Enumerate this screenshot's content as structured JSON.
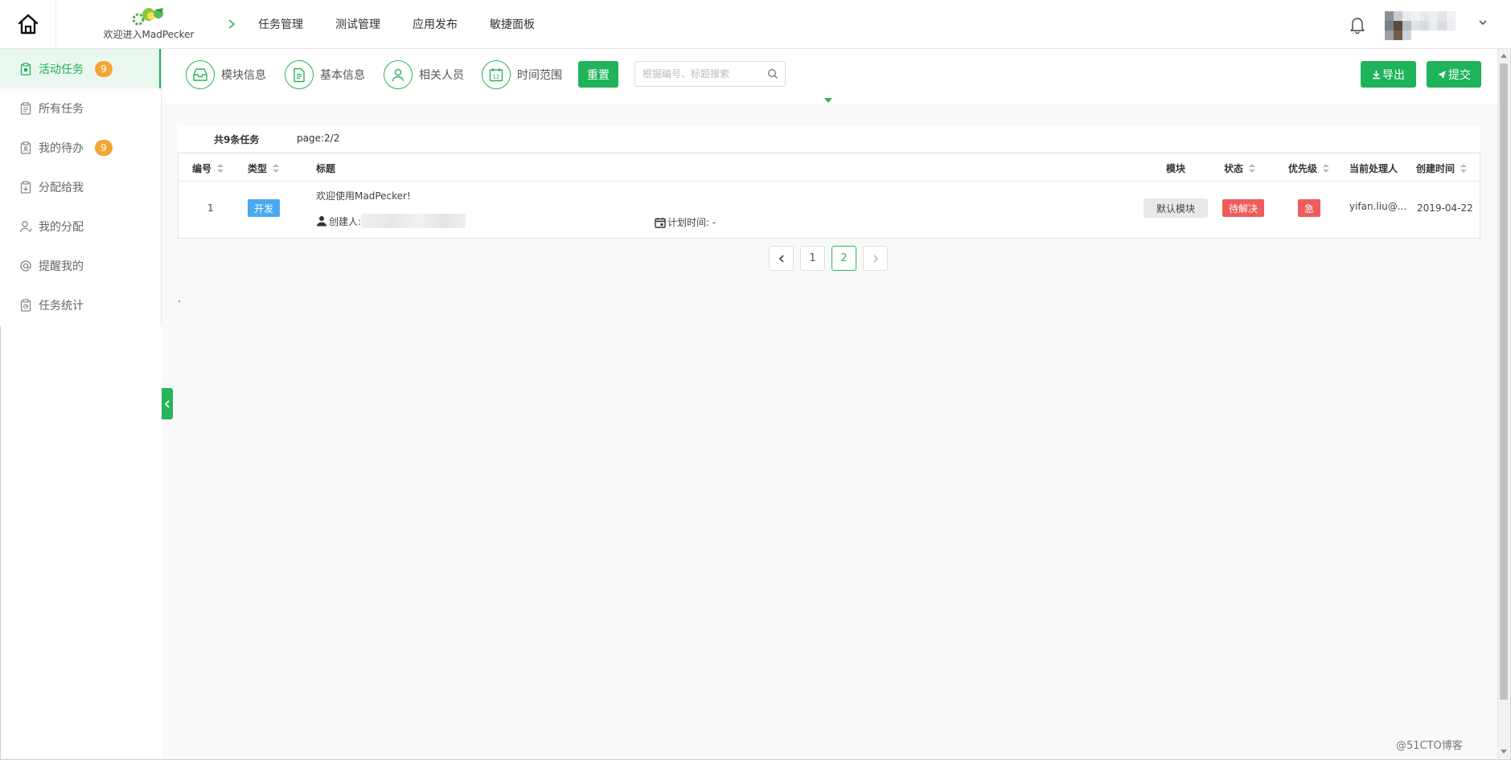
{
  "header": {
    "brand_text": "欢迎进入MadPecker",
    "nav": [
      "任务管理",
      "测试管理",
      "应用发布",
      "敏捷面板"
    ]
  },
  "sidebar": {
    "items": [
      {
        "label": "活动任务",
        "badge": "9",
        "active": true
      },
      {
        "label": "所有任务"
      },
      {
        "label": "我的待办",
        "badge": "9"
      },
      {
        "label": "分配给我"
      },
      {
        "label": "我的分配"
      },
      {
        "label": "提醒我的"
      },
      {
        "label": "任务统计"
      }
    ]
  },
  "filters": {
    "module": "模块信息",
    "basic": "基本信息",
    "people": "相关人员",
    "time": "时间范围",
    "calendar_day": "12",
    "reset": "重置",
    "search_placeholder": "根据编号、标题搜索",
    "export": "导出",
    "submit": "提交"
  },
  "summary": {
    "total": "共9条任务",
    "page": "page:2/2"
  },
  "table": {
    "headers": {
      "id": "编号",
      "type": "类型",
      "title": "标题",
      "module": "模块",
      "status": "状态",
      "priority": "优先级",
      "assignee": "当前处理人",
      "created": "创建时间"
    },
    "rows": [
      {
        "id": "1",
        "type": "开发",
        "title": "欢迎使用MadPecker!",
        "creator_label": "创建人:",
        "plan_label": "计划时间: -",
        "module": "默认模块",
        "status": "待解决",
        "priority": "急",
        "assignee": "yifan.liu@...",
        "created": "2019-04-22"
      }
    ]
  },
  "pagination": {
    "pages": [
      "1",
      "2"
    ],
    "current": "2"
  },
  "watermark": "@51CTO博客",
  "colors": {
    "accent": "#1fb35a",
    "badge": "#f3a536",
    "type_tag": "#4aa9f0",
    "danger": "#f05c5c"
  }
}
